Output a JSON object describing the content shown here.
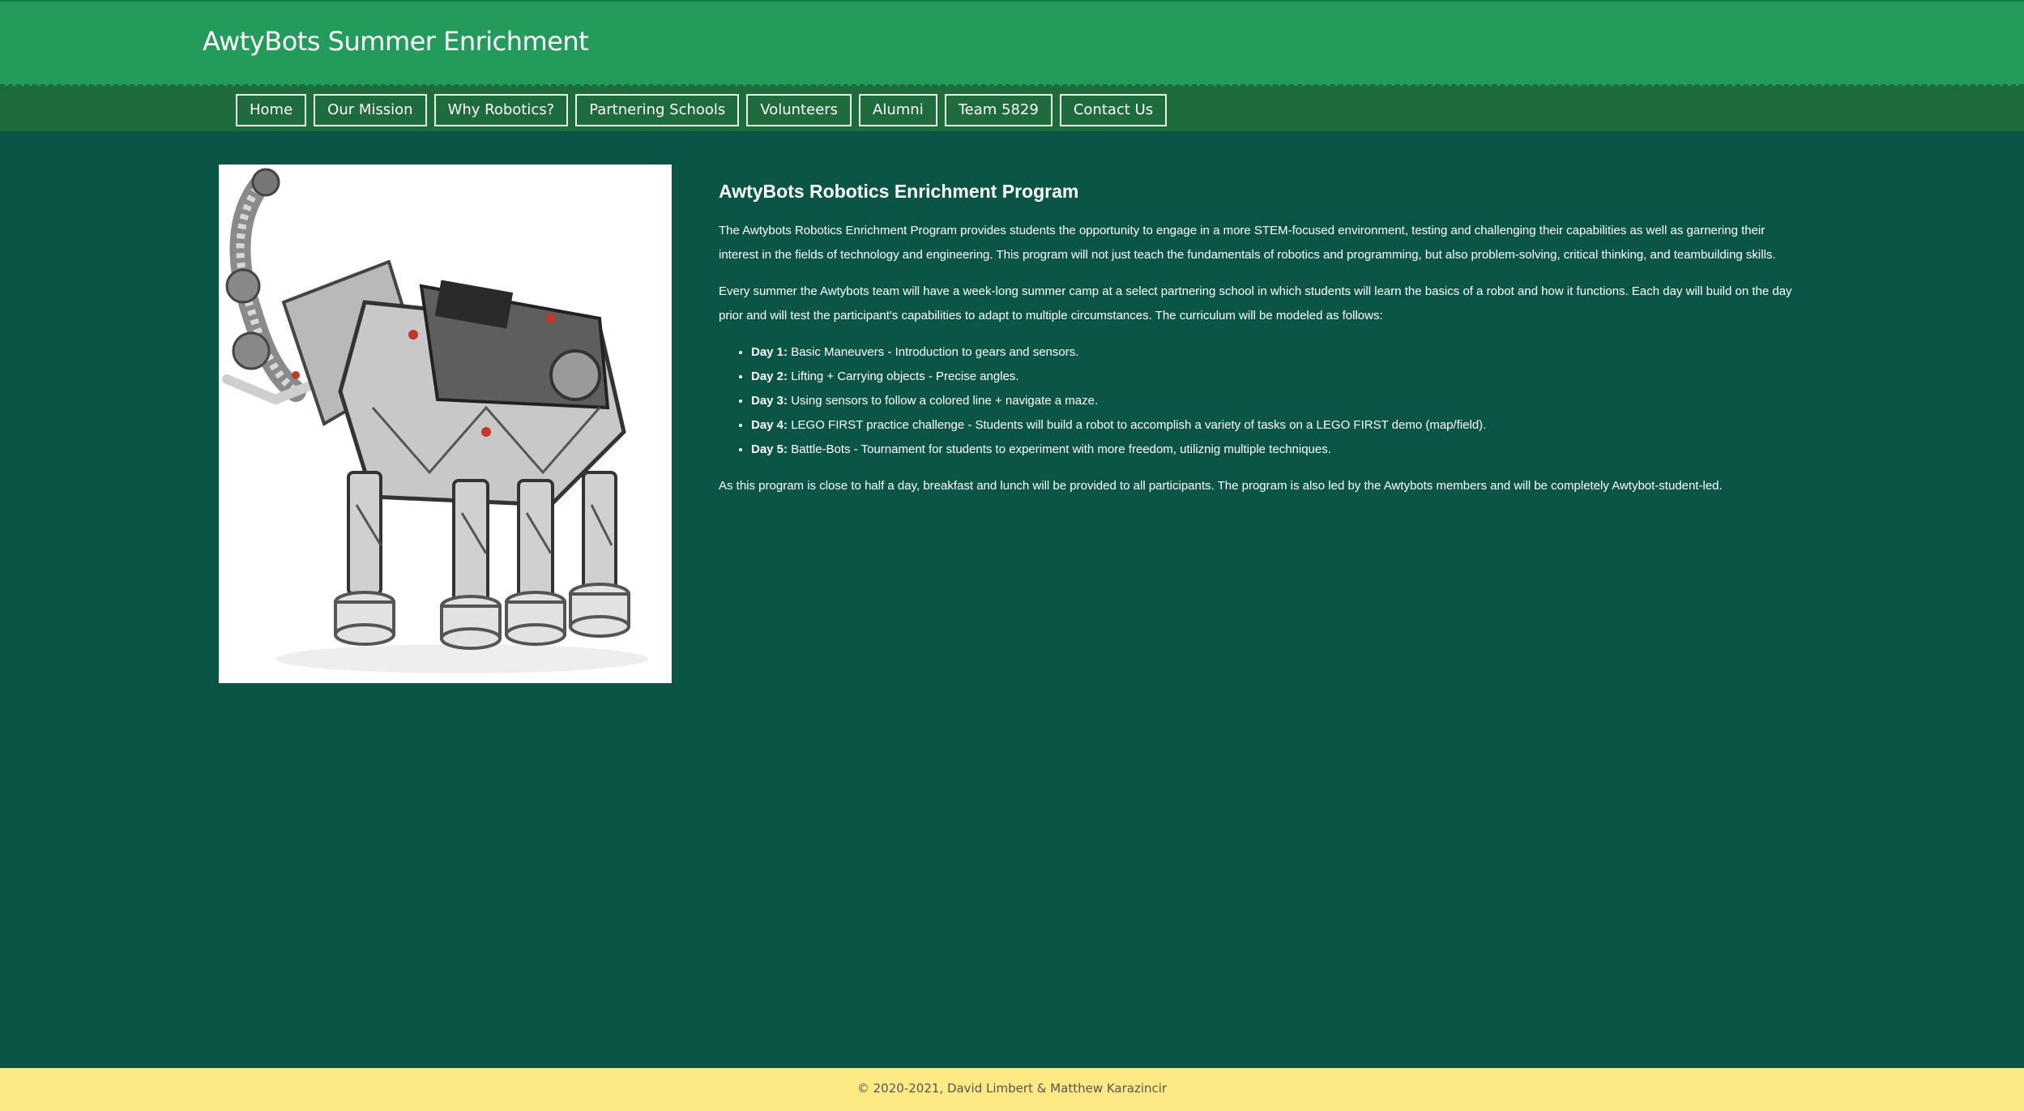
{
  "header": {
    "title": "AwtyBots Summer Enrichment"
  },
  "nav": {
    "items": [
      {
        "label": "Home"
      },
      {
        "label": "Our Mission"
      },
      {
        "label": "Why Robotics?"
      },
      {
        "label": "Partnering Schools"
      },
      {
        "label": "Volunteers"
      },
      {
        "label": "Alumni"
      },
      {
        "label": "Team 5829"
      },
      {
        "label": "Contact Us"
      }
    ]
  },
  "main": {
    "image": {
      "icon": "lego-robot-elephant-image"
    },
    "heading": "AwtyBots Robotics Enrichment Program",
    "paragraph1": "The Awtybots Robotics Enrichment Program provides students the opportunity to engage in a more STEM-focused environment, testing and challenging their capabilities as well as garnering their interest in the fields of technology and engineering. This program will not just teach the fundamentals of robotics and programming, but also problem-solving, critical thinking, and teambuilding skills.",
    "paragraph2": "Every summer the Awtybots team will have a week-long summer camp at a select partnering school in which students will learn the basics of a robot and how it functions. Each day will build on the day prior and will test the participant's capabilities to adapt to multiple circumstances. The curriculum will be modeled as follows:",
    "days": [
      {
        "label": "Day 1:",
        "text": " Basic Maneuvers - Introduction to gears and sensors."
      },
      {
        "label": "Day 2:",
        "text": " Lifting + Carrying objects - Precise angles."
      },
      {
        "label": "Day 3:",
        "text": " Using sensors to follow a colored line + navigate a maze."
      },
      {
        "label": "Day 4:",
        "text": " LEGO FIRST practice challenge - Students will build a robot to accomplish a variety of tasks on a LEGO FIRST demo (map/field)."
      },
      {
        "label": "Day 5:",
        "text": " Battle-Bots - Tournament for students to experiment with more freedom, utiliznig multiple techniques."
      }
    ],
    "paragraph3": "As this program is close to half a day, breakfast and lunch will be provided to all participants. The program is also led by the Awtybots members and will be completely Awtybot-student-led."
  },
  "footer": {
    "text": "© 2020-2021, David Limbert & Matthew Karazincir"
  },
  "colors": {
    "header": "#239b5a",
    "nav": "#1e6b3c",
    "background": "#0b5546",
    "footer": "#feea85"
  }
}
